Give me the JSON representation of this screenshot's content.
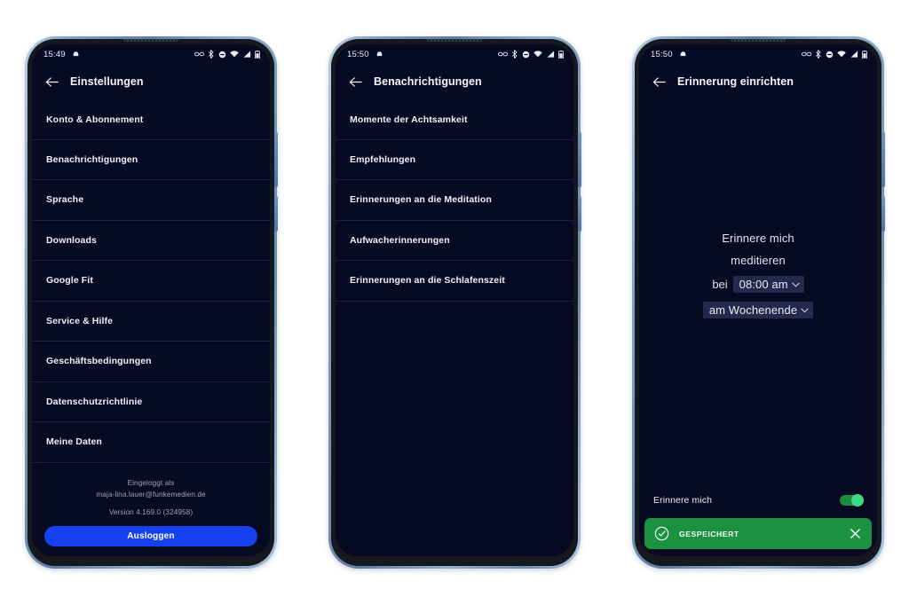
{
  "app": {
    "accent_blue": "#1641ef",
    "screen_bg": "#060a22",
    "divider": "#1b2145",
    "success_green": "#1b9240",
    "toggle_green": "#3ddc84",
    "select_bg": "#242a4b"
  },
  "phones": [
    {
      "status_bar": {
        "time": "15:49",
        "icons": [
          "notification-dot-icon",
          "glasses-icon",
          "bluetooth-icon",
          "dnd-icon",
          "wifi-icon",
          "signal-icon",
          "battery-icon"
        ]
      },
      "appbar": {
        "back": "back-arrow-icon",
        "title": "Einstellungen"
      },
      "list": [
        {
          "label": "Konto & Abonnement"
        },
        {
          "label": "Benachrichtigungen"
        },
        {
          "label": "Sprache"
        },
        {
          "label": "Downloads"
        },
        {
          "label": "Google Fit"
        },
        {
          "label": "Service & Hilfe"
        },
        {
          "label": "Geschäftsbedingungen"
        },
        {
          "label": "Datenschutzrichtlinie"
        },
        {
          "label": "Meine Daten"
        }
      ],
      "footer": {
        "logged_in_as": "Eingeloggt als",
        "email": "maja-lina.lauer@funkemedien.de",
        "version": "Version 4.169.0 (324958)"
      },
      "logout_label": "Ausloggen"
    },
    {
      "status_bar": {
        "time": "15:50",
        "icons": [
          "notification-dot-icon",
          "glasses-icon",
          "bluetooth-icon",
          "dnd-icon",
          "wifi-icon",
          "signal-icon",
          "battery-icon"
        ]
      },
      "appbar": {
        "back": "back-arrow-icon",
        "title": "Benachrichtigungen"
      },
      "list": [
        {
          "label": "Momente der Achtsamkeit"
        },
        {
          "label": "Empfehlungen"
        },
        {
          "label": "Erinnerungen an die Meditation"
        },
        {
          "label": "Aufwacherinnerungen"
        },
        {
          "label": "Erinnerungen an die Schlafenszeit"
        }
      ]
    },
    {
      "status_bar": {
        "time": "15:50",
        "icons": [
          "notification-dot-icon",
          "glasses-icon",
          "bluetooth-icon",
          "dnd-icon",
          "wifi-icon",
          "signal-icon",
          "battery-icon"
        ]
      },
      "appbar": {
        "back": "back-arrow-icon",
        "title": "Erinnerung einrichten"
      },
      "reminder": {
        "line1": "Erinnere mich",
        "line2": "meditieren",
        "time_prefix": "bei",
        "time_value": "08:00 am",
        "repeat_value": "am Wochenende"
      },
      "toggle": {
        "label": "Erinnere mich",
        "state": "on"
      },
      "snackbar": {
        "icon": "check-circle-icon",
        "text": "GESPEICHERT",
        "close": "close-icon"
      }
    }
  ]
}
